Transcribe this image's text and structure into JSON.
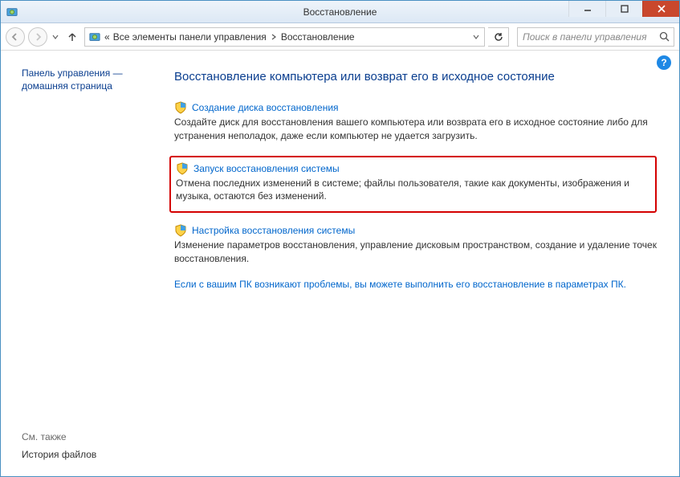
{
  "window": {
    "title": "Восстановление"
  },
  "breadcrumb": {
    "prefix": "«",
    "part1": "Все элементы панели управления",
    "part2": "Восстановление"
  },
  "search": {
    "placeholder": "Поиск в панели управления"
  },
  "sidebar": {
    "home_line1": "Панель управления —",
    "home_line2": "домашняя страница",
    "see_also": "См. также",
    "file_history": "История файлов"
  },
  "main": {
    "title": "Восстановление компьютера или возврат его в исходное состояние",
    "items": [
      {
        "link": "Создание диска восстановления",
        "desc": "Создайте диск для восстановления вашего компьютера или возврата его в исходное состояние либо для устранения неполадок, даже если компьютер не удается загрузить."
      },
      {
        "link": "Запуск восстановления системы",
        "desc": "Отмена последних изменений в системе; файлы пользователя, такие как документы, изображения и музыка, остаются без изменений."
      },
      {
        "link": "Настройка восстановления системы",
        "desc": "Изменение параметров восстановления, управление дисковым пространством, создание и удаление точек восстановления."
      }
    ],
    "extra_link": "Если с вашим ПК возникают проблемы, вы можете выполнить его восстановление в параметрах ПК."
  },
  "help_symbol": "?"
}
